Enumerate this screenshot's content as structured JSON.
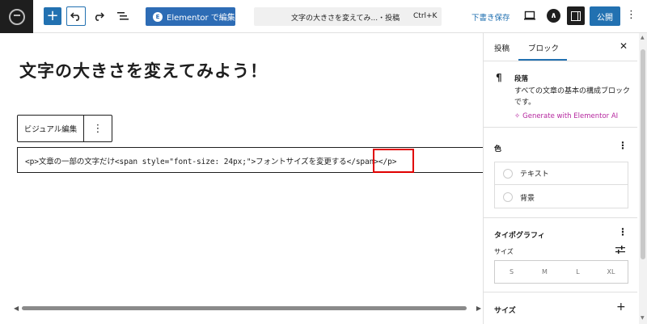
{
  "topbar": {
    "elementor_label": "Elementor で編集",
    "command_title": "文字の大きさを変えてみ...・投稿",
    "command_shortcut": "Ctrl+K",
    "save_draft_label": "下書き保存",
    "publish_label": "公開",
    "add_icon": "plus-icon",
    "undo_icon": "undo-icon",
    "redo_icon": "redo-icon",
    "list_view_icon": "list-view-icon",
    "accent_color": "#2271b1"
  },
  "editor": {
    "post_title": "文字の大きさを変えてみよう！",
    "block_toolbar": {
      "visual_edit_label": "ビジュアル編集"
    },
    "html_code": "<p>文章の一部の文字だけ<span style=\"font-size: 24px;\">フォントサイズを変更する</span></p>",
    "highlight_color": "#e00000"
  },
  "sidebar": {
    "tabs": [
      {
        "label": "投稿"
      },
      {
        "label": "ブロック"
      }
    ],
    "active_tab": "ブロック",
    "block": {
      "name": "段落",
      "description": "すべての文章の基本の構成ブロックです。",
      "ai_link": "Generate with Elementor AI"
    },
    "color_panel": {
      "title": "色",
      "items": [
        {
          "label": "テキスト"
        },
        {
          "label": "背景"
        }
      ]
    },
    "typography_panel": {
      "title": "タイポグラフィ",
      "size_label": "サイズ",
      "size_options": [
        "S",
        "M",
        "L",
        "XL"
      ]
    },
    "dimensions_panel": {
      "title": "サイズ"
    }
  }
}
